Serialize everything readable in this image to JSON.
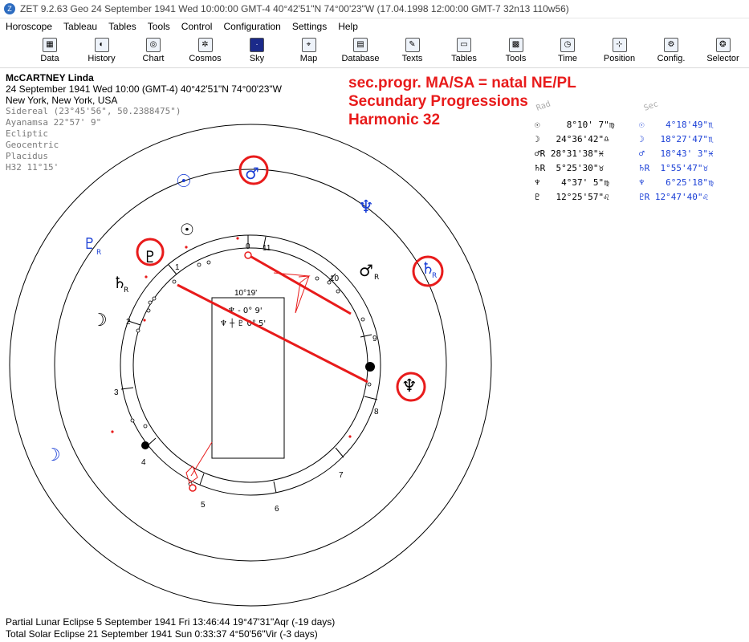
{
  "titlebar": {
    "text": "ZET 9.2.63 Geo   24 September 1941  Wed  10:00:00 GMT-4 40°42'51\"N  74°00'23\"W  (17.04.1998  12:00:00 GMT-7 32n13 110w56)"
  },
  "menu": [
    "Horoscope",
    "Tableau",
    "Tables",
    "Tools",
    "Control",
    "Configuration",
    "Settings",
    "Help"
  ],
  "toolbar": [
    {
      "label": "Data",
      "icon": "data-icon"
    },
    {
      "label": "History",
      "icon": "history-icon"
    },
    {
      "label": "Chart",
      "icon": "chart-icon"
    },
    {
      "label": "Cosmos",
      "icon": "cosmos-icon"
    },
    {
      "label": "Sky",
      "icon": "sky-icon"
    },
    {
      "label": "Map",
      "icon": "map-icon"
    },
    {
      "label": "Database",
      "icon": "database-icon"
    },
    {
      "label": "Texts",
      "icon": "texts-icon"
    },
    {
      "label": "Tables",
      "icon": "tables-icon"
    },
    {
      "label": "Tools",
      "icon": "tools-icon"
    },
    {
      "label": "Time",
      "icon": "time-icon"
    },
    {
      "label": "Position",
      "icon": "position-icon"
    },
    {
      "label": "Config.",
      "icon": "config-icon"
    },
    {
      "label": "Selector",
      "icon": "selector-icon"
    }
  ],
  "info": {
    "name": "McCARTNEY Linda",
    "line1": "24 September 1941  Wed  10:00 (GMT-4) 40°42'51\"N  74°00'23\"W",
    "line2": "New York, New York, USA",
    "settings": [
      "Sidereal (23°45'56\", 50.2388475\")",
      "Ayanamsa 22°57' 9\"",
      "Ecliptic",
      "Geocentric",
      "Placidus",
      "H32  11°15'"
    ]
  },
  "heading": {
    "line1": "sec.progr. MA/SA = natal NE/PL",
    "line2": "Secundary Progressions",
    "line3": "Harmonic 32"
  },
  "positions": {
    "hdr_left": "Rad",
    "hdr_right": "Sec",
    "rows": [
      {
        "left": "☉     8°10' 7\"♍",
        "right": "☉    4°18'49\"♏"
      },
      {
        "left": "☽   24°36'42\"♎",
        "right": "☽   18°27'47\"♏"
      },
      {
        "left": "♂R 28°31'38\"♓",
        "right": "♂   18°43' 3\"♓"
      },
      {
        "left": "♄R  5°25'30\"♉",
        "right": "♄R  1°55'47\"♉"
      },
      {
        "left": "♆    4°37' 5\"♍",
        "right": "♆    6°25'18\"♍"
      },
      {
        "left": "♇   12°25'57\"♌",
        "right": "♇R 12°47'40\"♌"
      }
    ]
  },
  "midpoint_box": {
    "title": "10°19'",
    "row1": "♆    - 0° 9'",
    "row2": "♆ ┼ ♇  0° 5'"
  },
  "houses": [
    "0",
    "11",
    "10",
    "9",
    "8",
    "7",
    "6",
    "5",
    "4",
    "3",
    "2",
    "1"
  ],
  "glyphs": {
    "sun": "☉",
    "moon": "☽",
    "mars": "♂",
    "saturn": "♄",
    "neptune": "♆",
    "pluto": "♇",
    "retro": "R"
  },
  "colors": {
    "accent_red": "#e81b1b",
    "blue": "#1a3fd6"
  },
  "footer": {
    "line1": "Partial Lunar Eclipse 5 September 1941 Fri 13:46:44 19°47'31\"Aqr (-19 days)",
    "line2": "Total Solar Eclipse 21 September 1941 Sun  0:33:37  4°50'56\"Vir (-3 days)"
  }
}
